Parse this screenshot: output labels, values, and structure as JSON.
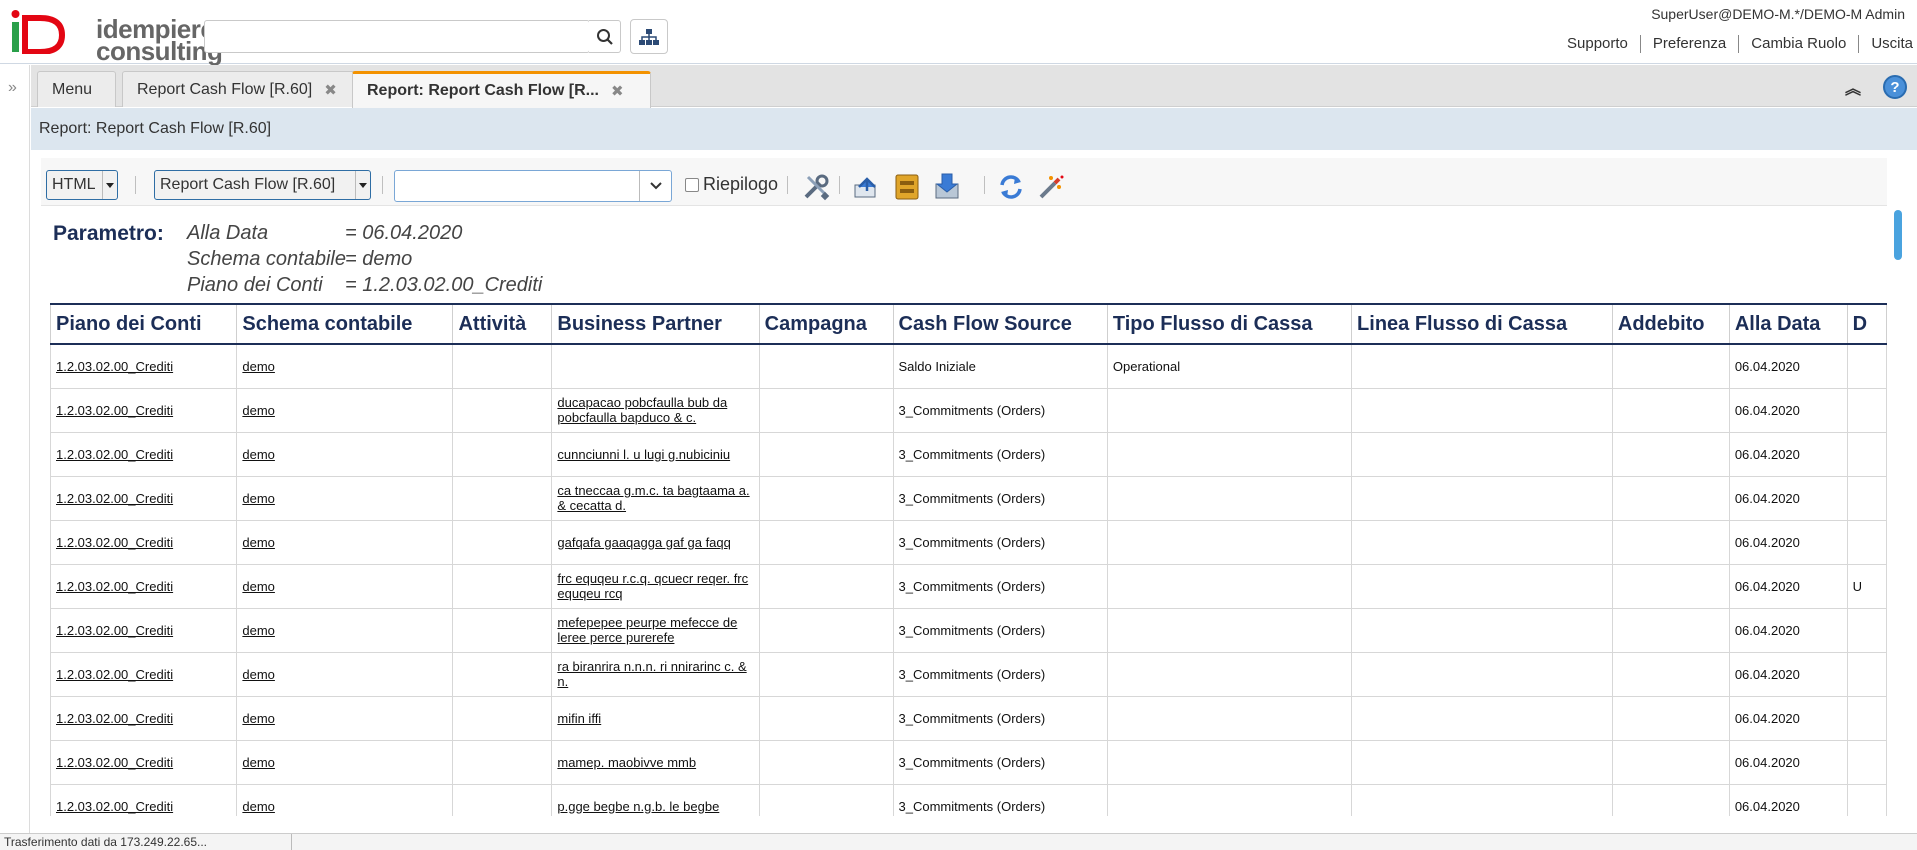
{
  "header": {
    "logo_text_1": "idempiere",
    "logo_text_2": "consulting",
    "search_value": "",
    "user": "SuperUser@DEMO-M.*/DEMO-M Admin",
    "links": [
      "Supporto",
      "Preferenza",
      "Cambia Ruolo",
      "Uscita"
    ]
  },
  "tabs": [
    {
      "label": "Menu",
      "closable": false,
      "active": false
    },
    {
      "label": "Report Cash Flow [R.60]",
      "closable": true,
      "active": false
    },
    {
      "label": "Report: Report Cash Flow [R...",
      "closable": true,
      "active": true
    }
  ],
  "title_strip": "Report: Report Cash Flow [R.60]",
  "toolbar": {
    "format": "HTML",
    "report": "Report Cash Flow [R.60]",
    "combo_value": "",
    "summary_label": "Riepilogo",
    "icons": [
      "customize-icon",
      "send-icon",
      "archive-icon",
      "export-icon",
      "refresh-icon",
      "wizard-icon"
    ]
  },
  "params": {
    "label": "Parametro:",
    "rows": [
      {
        "name": "Alla Data",
        "value": "= 06.04.2020"
      },
      {
        "name": "Schema contabile",
        "value": "= demo"
      },
      {
        "name": "Piano dei Conti",
        "value": "= 1.2.03.02.00_Crediti"
      }
    ]
  },
  "table": {
    "columns": [
      "Piano dei Conti",
      "Schema contabile",
      "Attività",
      "Business Partner",
      "Campagna",
      "Cash Flow Source",
      "Tipo Flusso di Cassa",
      "Linea Flusso di Cassa",
      "Addebito",
      "Alla Data",
      "D"
    ],
    "rows": [
      [
        "1.2.03.02.00_Crediti",
        "demo",
        "",
        "",
        "",
        "Saldo Iniziale",
        "Operational",
        "",
        "",
        "06.04.2020",
        ""
      ],
      [
        "1.2.03.02.00_Crediti",
        "demo",
        "",
        "ducapacao pobcfaulla bub da pobcfaulla bapduco & c.",
        "",
        "3_Commitments (Orders)",
        "",
        "",
        "",
        "06.04.2020",
        ""
      ],
      [
        "1.2.03.02.00_Crediti",
        "demo",
        "",
        "cunnciunni l. u lugi g.nubiciniu",
        "",
        "3_Commitments (Orders)",
        "",
        "",
        "",
        "06.04.2020",
        ""
      ],
      [
        "1.2.03.02.00_Crediti",
        "demo",
        "",
        "ca tneccaa g.m.c. ta bagtaama a. & cecatta d.",
        "",
        "3_Commitments (Orders)",
        "",
        "",
        "",
        "06.04.2020",
        ""
      ],
      [
        "1.2.03.02.00_Crediti",
        "demo",
        "",
        "gafqafa gaaqagga gaf ga faqq",
        "",
        "3_Commitments (Orders)",
        "",
        "",
        "",
        "06.04.2020",
        ""
      ],
      [
        "1.2.03.02.00_Crediti",
        "demo",
        "",
        "frc equqeu r.c.q. qcuecr reqer. frc equqeu rcq",
        "",
        "3_Commitments (Orders)",
        "",
        "",
        "",
        "06.04.2020",
        "U"
      ],
      [
        "1.2.03.02.00_Crediti",
        "demo",
        "",
        "mefepepee peurpe mefecce de leree perce purerefe",
        "",
        "3_Commitments (Orders)",
        "",
        "",
        "",
        "06.04.2020",
        ""
      ],
      [
        "1.2.03.02.00_Crediti",
        "demo",
        "",
        "ra biranrira n.n.n. ri nnirarinc c. & n.",
        "",
        "3_Commitments (Orders)",
        "",
        "",
        "",
        "06.04.2020",
        ""
      ],
      [
        "1.2.03.02.00_Crediti",
        "demo",
        "",
        "mifin iffi",
        "",
        "3_Commitments (Orders)",
        "",
        "",
        "",
        "06.04.2020",
        ""
      ],
      [
        "1.2.03.02.00_Crediti",
        "demo",
        "",
        "mamep. maobivve mmb",
        "",
        "3_Commitments (Orders)",
        "",
        "",
        "",
        "06.04.2020",
        ""
      ],
      [
        "1.2.03.02.00_Crediti",
        "demo",
        "",
        "p.gge begbe n.g.b. le begbe",
        "",
        "3_Commitments (Orders)",
        "",
        "",
        "",
        "06.04.2020",
        ""
      ]
    ]
  },
  "status": "Trasferimento dati da 173.249.22.65..."
}
